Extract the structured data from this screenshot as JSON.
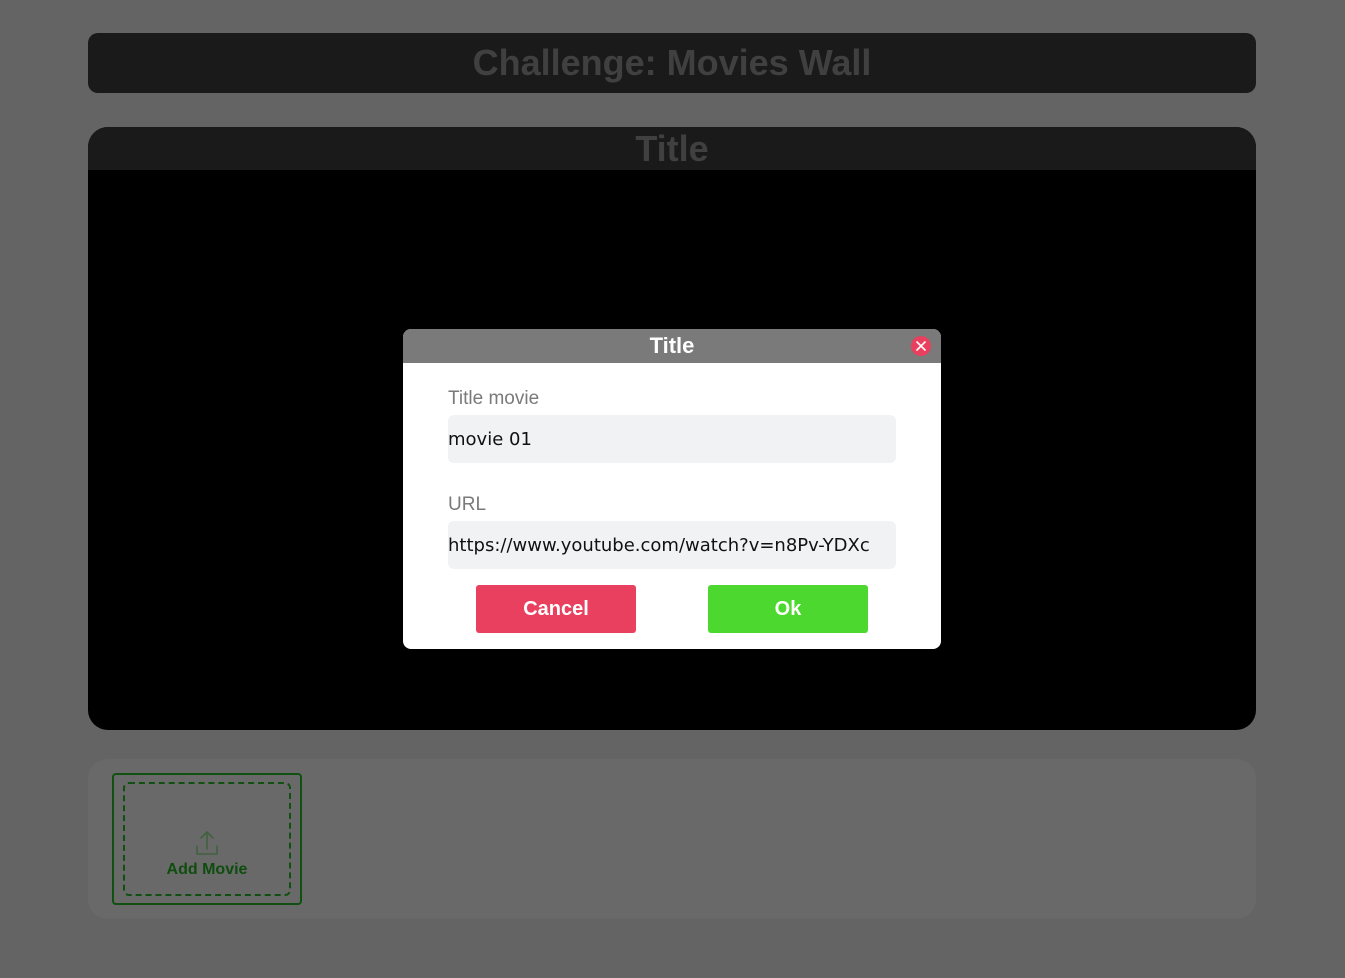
{
  "header": {
    "title": "Challenge: Movies Wall"
  },
  "player": {
    "title": "Title"
  },
  "gallery": {
    "add_label": "Add Movie"
  },
  "modal": {
    "title": "Title",
    "title_label": "Title movie",
    "title_value": "movie 01",
    "url_label": "URL",
    "url_value": "https://www.youtube.com/watch?v=n8Pv-YDXc",
    "cancel_label": "Cancel",
    "ok_label": "Ok"
  },
  "colors": {
    "accent_green": "#4cd82e",
    "accent_red": "#e8405e",
    "add_border": "#21a121"
  },
  "icons": {
    "close": "close-icon",
    "upload": "upload-icon"
  }
}
